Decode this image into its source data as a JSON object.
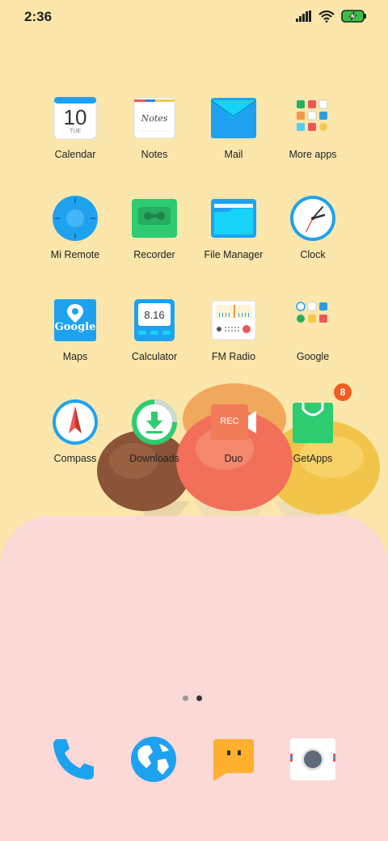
{
  "status": {
    "time": "2:36",
    "icons": [
      "signal-icon",
      "wifi-icon",
      "battery-charging-icon"
    ]
  },
  "apps": {
    "calendar": {
      "label": "Calendar",
      "day": "10",
      "weekday": "TUE"
    },
    "notes": {
      "label": "Notes",
      "icon_text": "Notes"
    },
    "mail": {
      "label": "Mail"
    },
    "more_apps": {
      "label": "More apps"
    },
    "mi_remote": {
      "label": "Mi Remote"
    },
    "recorder": {
      "label": "Recorder"
    },
    "file_manager": {
      "label": "File Manager"
    },
    "clock": {
      "label": "Clock"
    },
    "maps": {
      "label": "Maps",
      "icon_text": "Google"
    },
    "calculator": {
      "label": "Calculator",
      "display": "8.16"
    },
    "fm_radio": {
      "label": "FM Radio"
    },
    "google": {
      "label": "Google"
    },
    "compass": {
      "label": "Compass"
    },
    "downloads": {
      "label": "Downloads"
    },
    "duo": {
      "label": "Duo",
      "icon_text": "REC"
    },
    "getapps": {
      "label": "GetApps",
      "badge": "8"
    }
  },
  "dock": [
    "phone-icon",
    "browser-icon",
    "messages-icon",
    "camera-icon"
  ],
  "pages": {
    "count": 2,
    "current": 2
  },
  "colors": {
    "wallpaper": "#FBE6AC",
    "dock_panel": "#FBD9D7",
    "accent_blue": "#1EA2F0",
    "badge": "#F25C22"
  }
}
